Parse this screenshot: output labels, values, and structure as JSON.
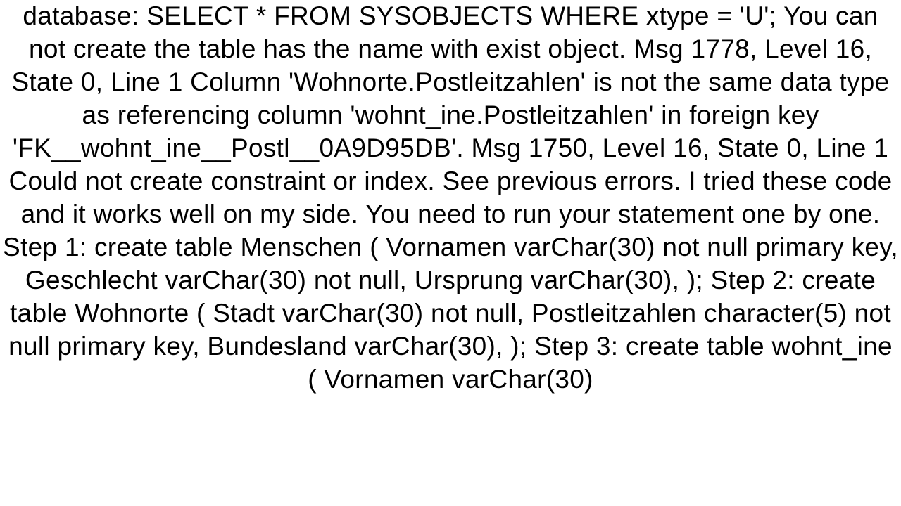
{
  "document": {
    "text": "database: SELECT * FROM SYSOBJECTS WHERE xtype = 'U';   You can not create the table has the name with exist object.  Msg 1778, Level 16, State 0, Line 1   Column 'Wohnorte.Postleitzahlen' is not the same data type as referencing column 'wohnt_ine.Postleitzahlen' in foreign key 'FK__wohnt_ine__Postl__0A9D95DB'. Msg 1750, Level 16, State 0, Line 1   Could not create constraint or index. See previous errors.  I tried these code and it works well on my side.  You need to run your statement one by one. Step 1: create table Menschen (     Vornamen varChar(30) not null primary key,     Geschlecht varChar(30) not null,     Ursprung varChar(30), );  Step 2: create table Wohnorte (     Stadt varChar(30) not null,     Postleitzahlen character(5) not null primary key,     Bundesland varChar(30), );  Step 3: create table wohnt_ine (     Vornamen varChar(30)"
  }
}
